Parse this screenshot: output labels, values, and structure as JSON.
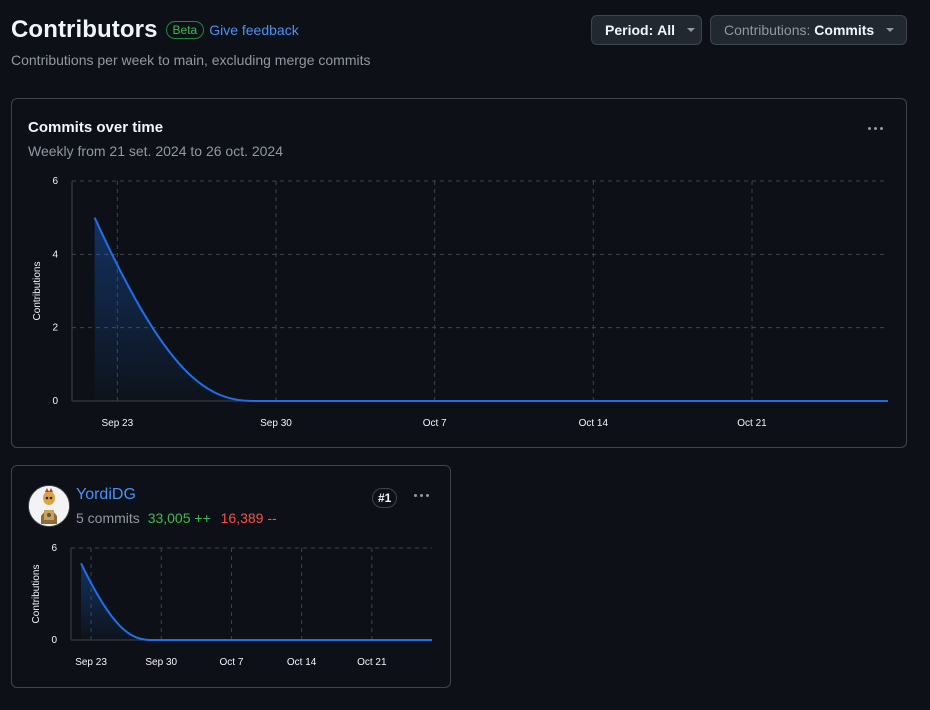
{
  "header": {
    "title": "Contributors",
    "beta": "Beta",
    "feedback": "Give feedback",
    "subtitle": "Contributions per week to main, excluding merge commits"
  },
  "controls": {
    "period_label": "Period:",
    "period_value": "All",
    "contrib_label": "Contributions:",
    "contrib_value": "Commits"
  },
  "main_card": {
    "title": "Commits over time",
    "subtitle": "Weekly from 21 set. 2024 to 26 oct. 2024"
  },
  "contributor": {
    "name": "YordiDG",
    "commits": "5 commits",
    "additions": "33,005 ++",
    "deletions": "16,389 --",
    "rank": "#1"
  },
  "colors": {
    "line": "#1f6feb",
    "accent": "#4493f8",
    "add": "#3fb950",
    "del": "#f85149"
  },
  "chart_data": [
    {
      "type": "area",
      "ylabel": "Contributions",
      "ylim": [
        0,
        6
      ],
      "yticks": [
        0,
        2,
        4,
        6
      ],
      "xticks": [
        "Sep 23",
        "Sep 30",
        "Oct 7",
        "Oct 14",
        "Oct 21"
      ],
      "x": [
        "2024-09-22",
        "2024-09-29",
        "2024-10-06",
        "2024-10-13",
        "2024-10-20",
        "2024-10-27"
      ],
      "values": [
        5,
        0,
        0,
        0,
        0,
        0
      ],
      "grid": true
    },
    {
      "type": "area",
      "ylabel": "Contributions",
      "ylim": [
        0,
        6
      ],
      "yticks": [
        0,
        6
      ],
      "xticks": [
        "Sep 23",
        "Sep 30",
        "Oct 7",
        "Oct 14",
        "Oct 21"
      ],
      "x": [
        "2024-09-22",
        "2024-09-29",
        "2024-10-06",
        "2024-10-13",
        "2024-10-20",
        "2024-10-27"
      ],
      "values": [
        5,
        0,
        0,
        0,
        0,
        0
      ],
      "grid": true
    }
  ]
}
